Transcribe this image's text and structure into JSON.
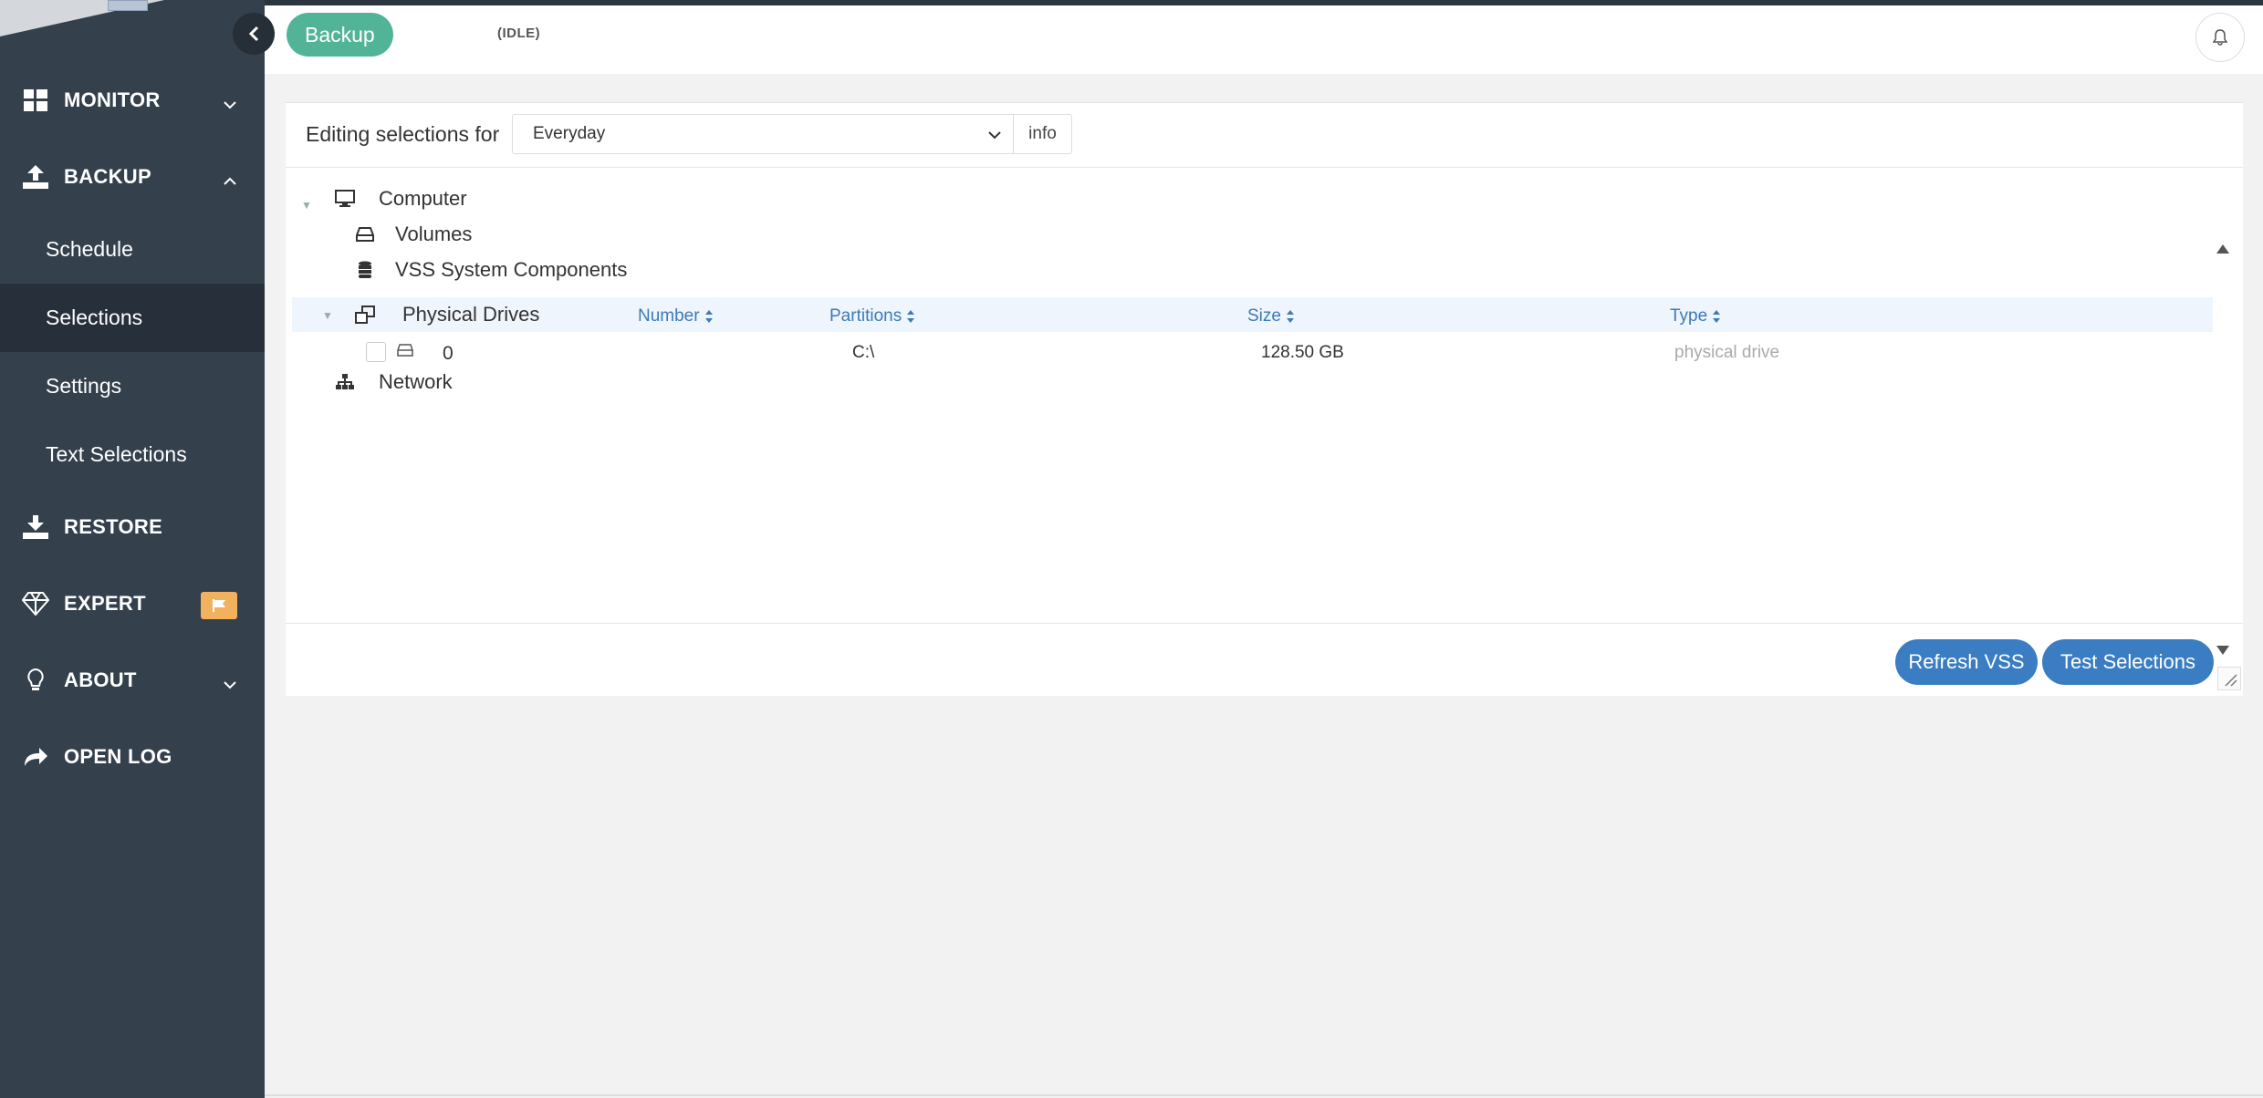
{
  "header": {
    "backup_label": "Backup",
    "status": "(IDLE)"
  },
  "sidebar": {
    "items": [
      {
        "label": "MONITOR",
        "icon": "dashboard-icon"
      },
      {
        "label": "BACKUP",
        "icon": "upload-icon"
      },
      {
        "label": "RESTORE",
        "icon": "download-icon"
      },
      {
        "label": "EXPERT",
        "icon": "diamond-icon"
      },
      {
        "label": "ABOUT",
        "icon": "lightbulb-icon"
      },
      {
        "label": "OPEN LOG",
        "icon": "share-arrow-icon"
      }
    ],
    "backup_sub": [
      {
        "label": "Schedule"
      },
      {
        "label": "Selections",
        "active": true
      },
      {
        "label": "Settings"
      },
      {
        "label": "Text Selections"
      }
    ]
  },
  "editor": {
    "label": "Editing selections for",
    "selected_set": "Everyday",
    "info_label": "info"
  },
  "tree": {
    "computer": "Computer",
    "volumes": "Volumes",
    "vss": "VSS System Components",
    "physical_drives": "Physical Drives",
    "network": "Network",
    "columns": {
      "number": "Number",
      "partitions": "Partitions",
      "size": "Size",
      "type": "Type"
    },
    "rows": [
      {
        "number": "0",
        "partitions": "C:\\",
        "size": "128.50 GB",
        "type": "physical drive"
      }
    ]
  },
  "actions": {
    "refresh_vss": "Refresh VSS",
    "test_selections": "Test Selections"
  },
  "colors": {
    "sidebar_bg": "#34404c",
    "accent_green": "#52b497",
    "accent_blue": "#3a7dc2",
    "flag_orange": "#f2b15f"
  }
}
